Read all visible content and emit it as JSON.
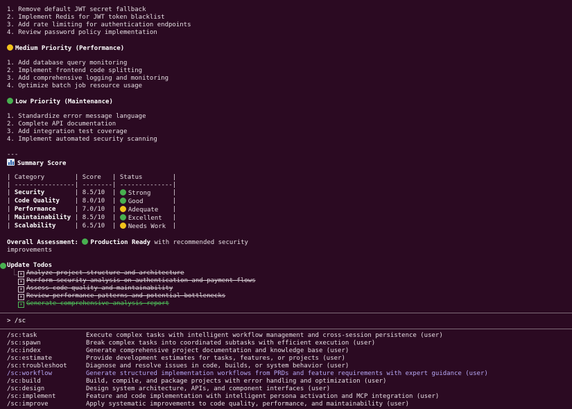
{
  "high_priority_items": [
    "1. Remove default JWT secret fallback",
    "2. Implement Redis for JWT token blacklist",
    "3. Add rate limiting for authentication endpoints",
    "4. Review password policy implementation"
  ],
  "medium_priority": {
    "heading": "Medium Priority (Performance)",
    "items": [
      "1. Add database query monitoring",
      "2. Implement frontend code splitting",
      "3. Add comprehensive logging and monitoring",
      "4. Optimize batch job resource usage"
    ]
  },
  "low_priority": {
    "heading": "Low Priority (Maintenance)",
    "items": [
      "1. Standardize error message language",
      "2. Complete API documentation",
      "3. Add integration test coverage",
      "4. Implement automated security scanning"
    ]
  },
  "separator": "---",
  "summary": {
    "heading": "Summary Score",
    "icon": "bar-chart-icon",
    "header": {
      "category": "Category",
      "score": "Score",
      "status": "Status"
    },
    "rule": {
      "category": "----------------",
      "score": "--------",
      "status": "--------------"
    },
    "rows": [
      {
        "category": "Security",
        "score": "8.5/10",
        "dot": "green",
        "status": "Strong"
      },
      {
        "category": "Code Quality",
        "score": "8.0/10",
        "dot": "green",
        "status": "Good"
      },
      {
        "category": "Performance",
        "score": "7.0/10",
        "dot": "yellow",
        "status": "Adequate"
      },
      {
        "category": "Maintainability",
        "score": "8.5/10",
        "dot": "green",
        "status": "Excellent"
      },
      {
        "category": "Scalability",
        "score": "6.5/10",
        "dot": "yellow",
        "status": "Needs Work"
      }
    ]
  },
  "assessment": {
    "label": "Overall Assessment:",
    "verdict": "Production Ready",
    "rest": "with recommended security improvements"
  },
  "todos": {
    "heading": "Update Todos",
    "items": [
      {
        "text": "Analyze project structure and architecture",
        "green": false
      },
      {
        "text": "Perform security analysis on authentication and payment flows",
        "green": false
      },
      {
        "text": "Assess code quality and maintainability",
        "green": false
      },
      {
        "text": "Review performance patterns and potential bottlenecks",
        "green": false
      },
      {
        "text": "Generate comprehensive analysis report",
        "green": true
      }
    ]
  },
  "prompt": {
    "symbol": ">",
    "value": "/sc"
  },
  "commands": [
    {
      "name": "/sc:task",
      "desc": "Execute complex tasks with intelligent workflow management and cross-session persistence (user)"
    },
    {
      "name": "/sc:spawn",
      "desc": "Break complex tasks into coordinated subtasks with efficient execution (user)"
    },
    {
      "name": "/sc:index",
      "desc": "Generate comprehensive project documentation and knowledge base (user)"
    },
    {
      "name": "/sc:estimate",
      "desc": "Provide development estimates for tasks, features, or projects (user)"
    },
    {
      "name": "/sc:troubleshoot",
      "desc": "Diagnose and resolve issues in code, builds, or system behavior (user)"
    },
    {
      "name": "/sc:workflow",
      "desc": "Generate structured implementation workflows from PRDs and feature requirements with expert guidance (user)",
      "selected": true
    },
    {
      "name": "/sc:build",
      "desc": "Build, compile, and package projects with error handling and optimization (user)"
    },
    {
      "name": "/sc:design",
      "desc": "Design system architecture, APIs, and component interfaces (user)"
    },
    {
      "name": "/sc:implement",
      "desc": "Feature and code implementation with intelligent persona activation and MCP integration (user)"
    },
    {
      "name": "/sc:improve",
      "desc": "Apply systematic improvements to code quality, performance, and maintainability (user)"
    }
  ],
  "colors": {
    "background": "#2b0a22",
    "text": "#e6dde3",
    "selected": "#b7a7f5",
    "green": "#48b050",
    "yellow": "#f2c21b"
  }
}
